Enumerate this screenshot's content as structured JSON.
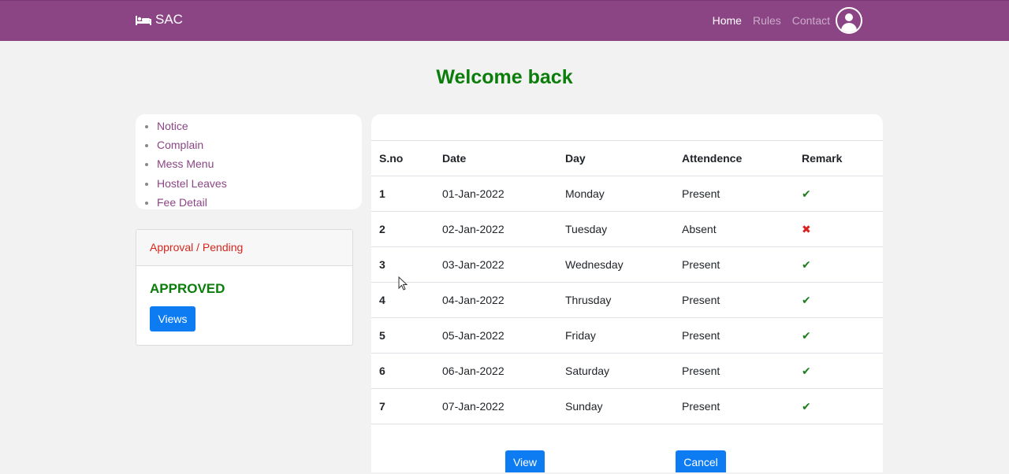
{
  "navbar": {
    "brand": "SAC",
    "links": [
      {
        "label": "Home",
        "active": true
      },
      {
        "label": "Rules",
        "active": false
      },
      {
        "label": "Contact",
        "active": false
      }
    ],
    "brand_color": "#8b4585"
  },
  "welcome": "Welcome back",
  "menu": {
    "items": [
      "Notice",
      "Complain",
      "Mess Menu",
      "Hostel Leaves",
      "Fee Detail"
    ]
  },
  "approval": {
    "header": "Approval / Pending",
    "status": "APPROVED",
    "button": "Views"
  },
  "table": {
    "headers": [
      "S.no",
      "Date",
      "Day",
      "Attendence",
      "Remark"
    ],
    "rows": [
      {
        "sno": "1",
        "date": "01-Jan-2022",
        "day": "Monday",
        "attendance": "Present",
        "remark": "check"
      },
      {
        "sno": "2",
        "date": "02-Jan-2022",
        "day": "Tuesday",
        "attendance": "Absent",
        "remark": "cross"
      },
      {
        "sno": "3",
        "date": "03-Jan-2022",
        "day": "Wednesday",
        "attendance": "Present",
        "remark": "check"
      },
      {
        "sno": "4",
        "date": "04-Jan-2022",
        "day": "Thrusday",
        "attendance": "Present",
        "remark": "check"
      },
      {
        "sno": "5",
        "date": "05-Jan-2022",
        "day": "Friday",
        "attendance": "Present",
        "remark": "check"
      },
      {
        "sno": "6",
        "date": "06-Jan-2022",
        "day": "Saturday",
        "attendance": "Present",
        "remark": "check"
      },
      {
        "sno": "7",
        "date": "07-Jan-2022",
        "day": "Sunday",
        "attendance": "Present",
        "remark": "check"
      }
    ]
  },
  "actions": {
    "view": "View",
    "cancel": "Cancel"
  },
  "colors": {
    "accent": "#0d7bf2",
    "success": "#0a7d0a",
    "danger": "#d9261c"
  }
}
